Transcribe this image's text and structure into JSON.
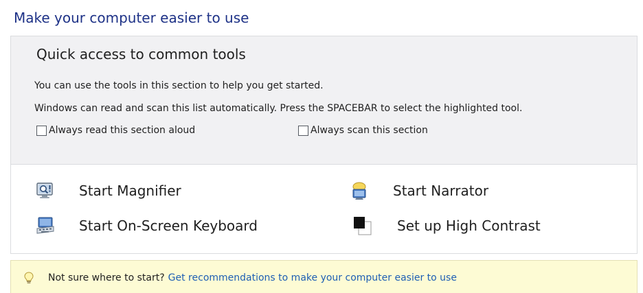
{
  "page_title": "Make your computer easier to use",
  "quick_access": {
    "heading": "Quick access to common tools",
    "description": "You can use the tools in this section to help you get started.",
    "scan_note": "Windows can read and scan this list automatically.  Press the SPACEBAR to select the highlighted tool.",
    "checkboxes": [
      {
        "label": "Always read this section aloud",
        "checked": false
      },
      {
        "label": "Always scan this section",
        "checked": false
      }
    ],
    "tools": [
      {
        "label": "Start Magnifier",
        "icon": "magnifier-icon"
      },
      {
        "label": "Start Narrator",
        "icon": "narrator-icon"
      },
      {
        "label": "Start On-Screen Keyboard",
        "icon": "keyboard-icon"
      },
      {
        "label": "Set up High Contrast",
        "icon": "high-contrast-icon"
      }
    ]
  },
  "tip": {
    "icon": "lightbulb-icon",
    "text": "Not sure where to start?",
    "link": "Get recommendations to make your computer easier to use"
  },
  "colors": {
    "title": "#1e3287",
    "link": "#1e5fb4",
    "panel_background": "#f1f1f3",
    "tip_background": "#fdfbd4"
  }
}
